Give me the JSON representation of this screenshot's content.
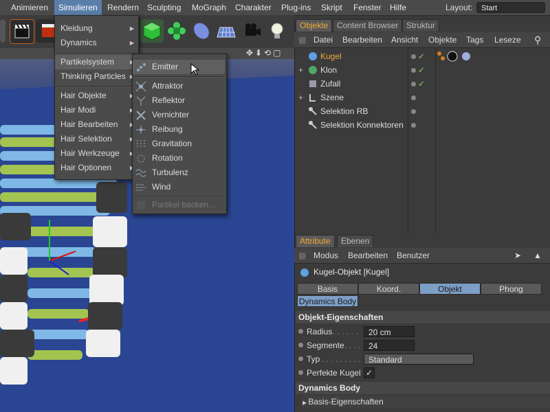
{
  "menubar": {
    "items": [
      "Animieren",
      "Simulieren",
      "Rendern",
      "Sculpting",
      "MoGraph",
      "Charakter",
      "Plug-ins",
      "Skript",
      "Fenster",
      "Hilfe"
    ],
    "active": "Simulieren",
    "layout_label": "Layout:",
    "layout_value": "Start"
  },
  "menu_simulieren": {
    "items": [
      "Kleidung",
      "Dynamics",
      "Partikelsystem",
      "Thinking Particles",
      "Hair Objekte",
      "Hair Modi",
      "Hair Bearbeiten",
      "Hair Selektion",
      "Hair Werkzeuge",
      "Hair Optionen"
    ],
    "highlighted": "Partikelsystem"
  },
  "submenu_partikelsystem": {
    "items": [
      "Emitter",
      "Attraktor",
      "Reflektor",
      "Vernichter",
      "Reibung",
      "Gravitation",
      "Rotation",
      "Turbulenz",
      "Wind",
      "Partikel backen..."
    ],
    "highlighted": "Emitter",
    "disabled": "Partikel backen..."
  },
  "object_manager": {
    "tabs": [
      "Objekte",
      "Content Browser",
      "Struktur"
    ],
    "active_tab": "Objekte",
    "menu": [
      "Datei",
      "Bearbeiten",
      "Ansicht",
      "Objekte",
      "Tags",
      "Leseze"
    ],
    "tree": [
      {
        "name": "Kugel",
        "selected": true,
        "expander": ""
      },
      {
        "name": "Klon",
        "selected": false,
        "expander": "+"
      },
      {
        "name": "Zufall",
        "selected": false,
        "expander": ""
      },
      {
        "name": "Szene",
        "selected": false,
        "expander": "+"
      },
      {
        "name": "Selektion RB",
        "selected": false,
        "expander": ""
      },
      {
        "name": "Selektion Konnektoren",
        "selected": false,
        "expander": ""
      }
    ]
  },
  "attribute_manager": {
    "tabs": [
      "Attribute",
      "Ebenen"
    ],
    "active_tab": "Attribute",
    "menu": [
      "Modus",
      "Bearbeiten",
      "Benutzer"
    ],
    "object_title": "Kugel-Objekt [Kugel]",
    "segments": [
      "Basis",
      "Koord.",
      "Objekt",
      "Phong"
    ],
    "active_segment": "Objekt",
    "extra_segment": "Dynamics Body",
    "section_title": "Objekt-Eigenschaften",
    "fields": {
      "radius_label": "Radius",
      "radius_value": "20 cm",
      "segmente_label": "Segmente",
      "segmente_value": "24",
      "typ_label": "Typ",
      "typ_value": "Standard",
      "perfekt_label": "Perfekte Kugel",
      "perfekt_checked": "✓"
    },
    "section2_title": "Dynamics Body",
    "subsection": "Basis-Eigenschaften"
  },
  "colors": {
    "accent_orange": "#f0a93a",
    "highlight_blue": "#5a7ea8",
    "viewport_blue": "#24408f"
  }
}
